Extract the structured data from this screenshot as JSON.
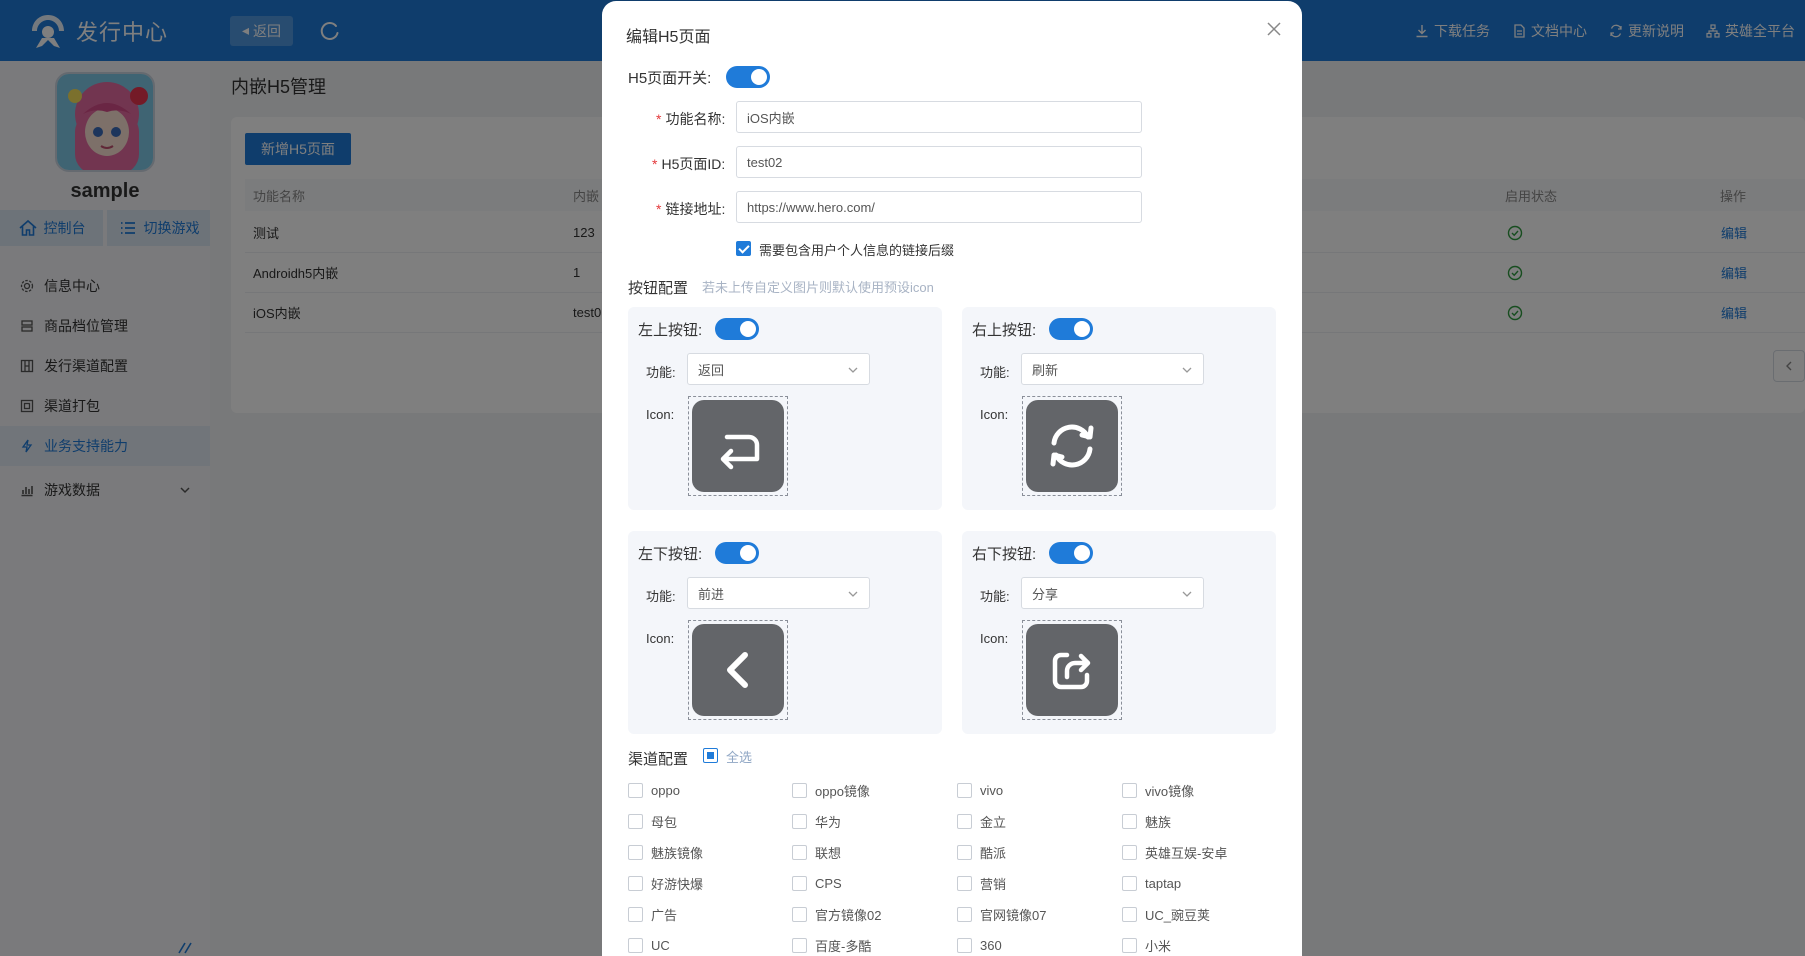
{
  "topbar": {
    "brand": "发行中心",
    "back_label": "返回",
    "links": [
      "下载任务",
      "文档中心",
      "更新说明",
      "英雄全平台"
    ]
  },
  "sidebar": {
    "app_name": "sample",
    "tabs": [
      "控制台",
      "切换游戏"
    ],
    "menu": [
      "信息中心",
      "商品档位管理",
      "发行渠道配置",
      "渠道打包",
      "业务支持能力",
      "游戏数据"
    ]
  },
  "main": {
    "title": "内嵌H5管理",
    "add_button": "新增H5页面",
    "headers": {
      "name": "功能名称",
      "embed": "内嵌",
      "status": "启用状态",
      "action": "操作"
    },
    "rows": [
      {
        "name": "测试",
        "embed": "123",
        "action": "编辑"
      },
      {
        "name": "Androidh5内嵌",
        "embed": "1",
        "action": "编辑"
      },
      {
        "name": "iOS内嵌",
        "embed": "test0",
        "action": "编辑"
      }
    ]
  },
  "modal": {
    "title": "编辑H5页面",
    "switch_label": "H5页面开关:",
    "fields": {
      "name_label": "功能名称:",
      "name_value": "iOS内嵌",
      "id_label": "H5页面ID:",
      "id_value": "test02",
      "url_label": "链接地址:",
      "url_value": "https://www.hero.com/"
    },
    "suffix_checkbox": "需要包含用户个人信息的链接后缀",
    "button_config": {
      "title": "按钮配置",
      "hint": "若未上传自定义图片则默认使用预设icon",
      "func_label": "功能:",
      "icon_label": "Icon:",
      "panels": [
        {
          "title": "左上按钮:",
          "func": "返回",
          "icon": "return-icon"
        },
        {
          "title": "右上按钮:",
          "func": "刷新",
          "icon": "refresh-icon"
        },
        {
          "title": "左下按钮:",
          "func": "前进",
          "icon": "chevron-left-icon"
        },
        {
          "title": "右下按钮:",
          "func": "分享",
          "icon": "share-icon"
        }
      ]
    },
    "channel_config": {
      "title": "渠道配置",
      "select_all": "全选",
      "channels": [
        "oppo",
        "oppo镜像",
        "vivo",
        "vivo镜像",
        "母包",
        "华为",
        "金立",
        "魅族",
        "魅族镜像",
        "联想",
        "酷派",
        "英雄互娱-安卓",
        "好游快爆",
        "CPS",
        "营销",
        "taptap",
        "广告",
        "官方镜像02",
        "官网镜像07",
        "UC_豌豆荚",
        "UC",
        "百度-多酷",
        "360",
        "小米"
      ]
    }
  },
  "colors": {
    "primary": "#1f7bd9",
    "success": "#2e9a3e",
    "icon_tile": "#636569"
  }
}
